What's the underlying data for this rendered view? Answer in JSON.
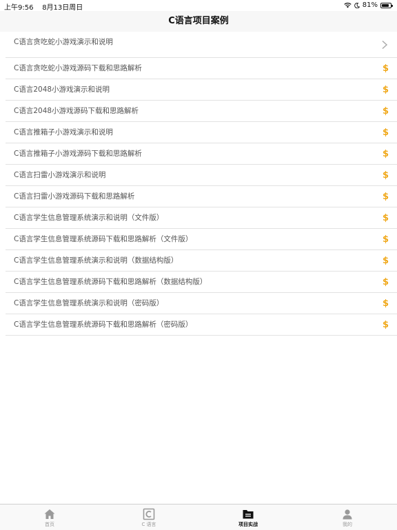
{
  "status": {
    "time": "上午9:56",
    "date": "8月13日周日",
    "battery": "81%"
  },
  "nav": {
    "title": "C语言项目案例"
  },
  "items": [
    {
      "label": "C语言贪吃蛇小游戏演示和说明",
      "accessory": "chevron"
    },
    {
      "label": "C语言贪吃蛇小游戏源码下载和思路解析",
      "accessory": "$"
    },
    {
      "label": "C语言2048小游戏演示和说明",
      "accessory": "$"
    },
    {
      "label": "C语言2048小游戏源码下载和思路解析",
      "accessory": "$"
    },
    {
      "label": "C语言推箱子小游戏演示和说明",
      "accessory": "$"
    },
    {
      "label": "C语言推箱子小游戏源码下载和思路解析",
      "accessory": "$"
    },
    {
      "label": "C语言扫雷小游戏演示和说明",
      "accessory": "$"
    },
    {
      "label": "C语言扫雷小游戏源码下载和思路解析",
      "accessory": "$"
    },
    {
      "label": "C语言学生信息管理系统演示和说明（文件版）",
      "accessory": "$"
    },
    {
      "label": "C语言学生信息管理系统源码下载和思路解析（文件版）",
      "accessory": "$"
    },
    {
      "label": "C语言学生信息管理系统演示和说明（数据结构版）",
      "accessory": "$"
    },
    {
      "label": "C语言学生信息管理系统源码下载和思路解析（数据结构版）",
      "accessory": "$"
    },
    {
      "label": "C语言学生信息管理系统演示和说明（密码版）",
      "accessory": "$"
    },
    {
      "label": "C语言学生信息管理系统源码下载和思路解析（密码版）",
      "accessory": "$"
    }
  ],
  "tabs": [
    {
      "label": "首页",
      "icon": "home-icon",
      "active": false
    },
    {
      "label": "C 语言",
      "icon": "c-language-icon",
      "active": false
    },
    {
      "label": "项目实战",
      "icon": "folder-icon",
      "active": true
    },
    {
      "label": "我的",
      "icon": "person-icon",
      "active": false
    }
  ],
  "colors": {
    "accent": "#f0a81a",
    "active_tab": "#111111",
    "inactive_tab": "#9a9a9a"
  }
}
